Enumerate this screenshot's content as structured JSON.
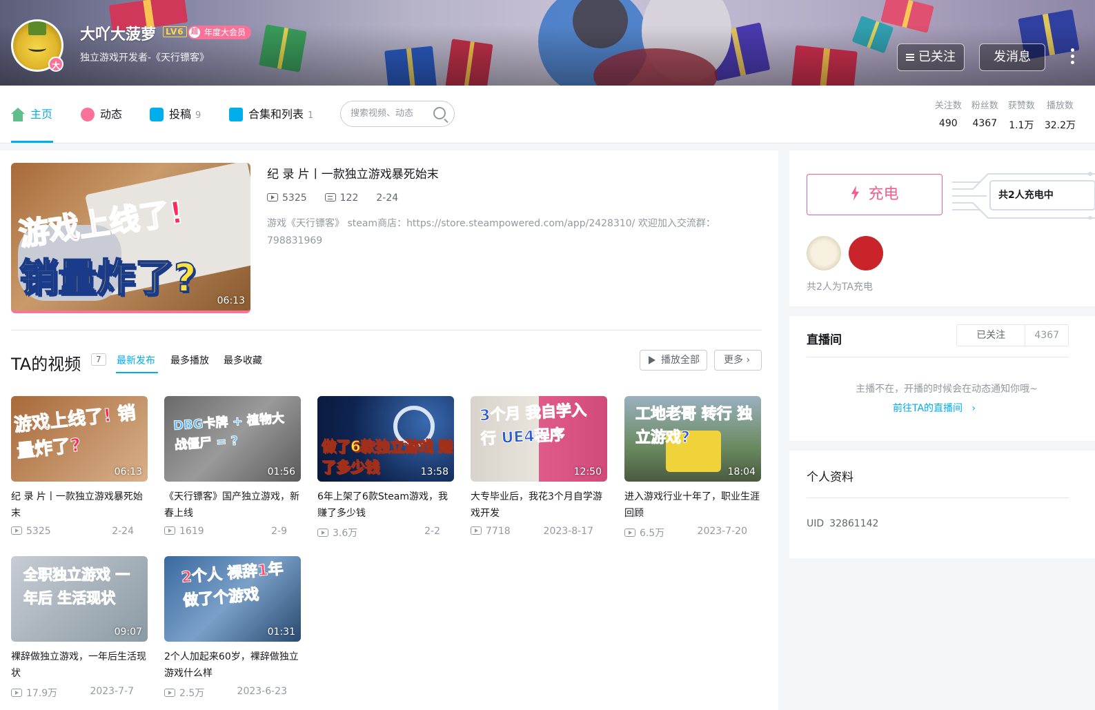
{
  "profile": {
    "name": "大吖大菠萝",
    "level": "LV6",
    "vip_mark": "超",
    "vip_label": "年度大会员",
    "avatar_badge": "大",
    "sign": "独立游戏开发者-《天行镖客》",
    "follow_button": "已关注",
    "message_button": "发消息"
  },
  "nav": {
    "tabs": [
      {
        "label": "主页",
        "count": ""
      },
      {
        "label": "动态",
        "count": ""
      },
      {
        "label": "投稿",
        "count": "9"
      },
      {
        "label": "合集和列表",
        "count": "1"
      }
    ],
    "search_placeholder": "搜索视频、动态"
  },
  "stats": [
    {
      "label": "关注数",
      "value": "490"
    },
    {
      "label": "粉丝数",
      "value": "4367"
    },
    {
      "label": "获赞数",
      "value": "1.1万"
    },
    {
      "label": "播放数",
      "value": "32.2万"
    }
  ],
  "top_video": {
    "title": "纪 录 片丨一款独立游戏暴死始末",
    "plays": "5325",
    "danmaku": "122",
    "date": "2-24",
    "desc": "游戏《天行镖客》 steam商店：https://store.steampowered.com/app/2428310/ 欢迎加入交流群：798831969",
    "duration": "06:13",
    "cover_line1": "游戏上线了!",
    "cover_line2": "销量炸了?"
  },
  "videos_section": {
    "title": "TA的视频",
    "count": "7",
    "sorts": [
      "最新发布",
      "最多播放",
      "最多收藏"
    ],
    "play_all": "播放全部",
    "more": "更多"
  },
  "videos": [
    {
      "title": "纪 录 片丨一款独立游戏暴死始末",
      "plays": "5325",
      "date": "2-24",
      "duration": "06:13",
      "cover": "游戏上线了! 销量炸了?"
    },
    {
      "title": "《天行镖客》国产独立游戏，新春上线",
      "plays": "1619",
      "date": "2-9",
      "duration": "01:56",
      "cover": "DBG卡牌 + 植物大战僵尸 = ?"
    },
    {
      "title": "6年上架了6款Steam游戏，我赚了多少钱",
      "plays": "3.6万",
      "date": "2-2",
      "duration": "13:58",
      "cover": "做了6款独立游戏 赚了多少钱"
    },
    {
      "title": "大专毕业后，我花3个月自学游戏开发",
      "plays": "7718",
      "date": "2023-8-17",
      "duration": "12:50",
      "cover": "3个月 我自学入行 UE4程序"
    },
    {
      "title": "进入游戏行业十年了，职业生涯回顾",
      "plays": "6.5万",
      "date": "2023-7-20",
      "duration": "18:04",
      "cover": "工地老哥 转行 独立游戏?"
    },
    {
      "title": "裸辞做独立游戏，一年后生活现状",
      "plays": "17.9万",
      "date": "2023-7-7",
      "duration": "09:07",
      "cover": "全职独立游戏 一年后 生活现状"
    },
    {
      "title": "2个人加起来60岁，裸辞做独立游戏什么样",
      "plays": "2.5万",
      "date": "2023-6-23",
      "duration": "01:31",
      "cover": "2个人 裸辞1年 做了个游戏"
    }
  ],
  "charge": {
    "button": "充电",
    "count_prefix": "共",
    "count_num": "2",
    "count_suffix": "人充电中",
    "supporters_text": "共2人为TA充电"
  },
  "live": {
    "title": "直播间",
    "follow": "已关注",
    "fans": "4367",
    "empty": "主播不在，开播的时候会在动态通知你哦~",
    "link": "前往TA的直播间"
  },
  "info": {
    "title": "个人资料",
    "uid_label": "UID",
    "uid_value": "32861142"
  }
}
